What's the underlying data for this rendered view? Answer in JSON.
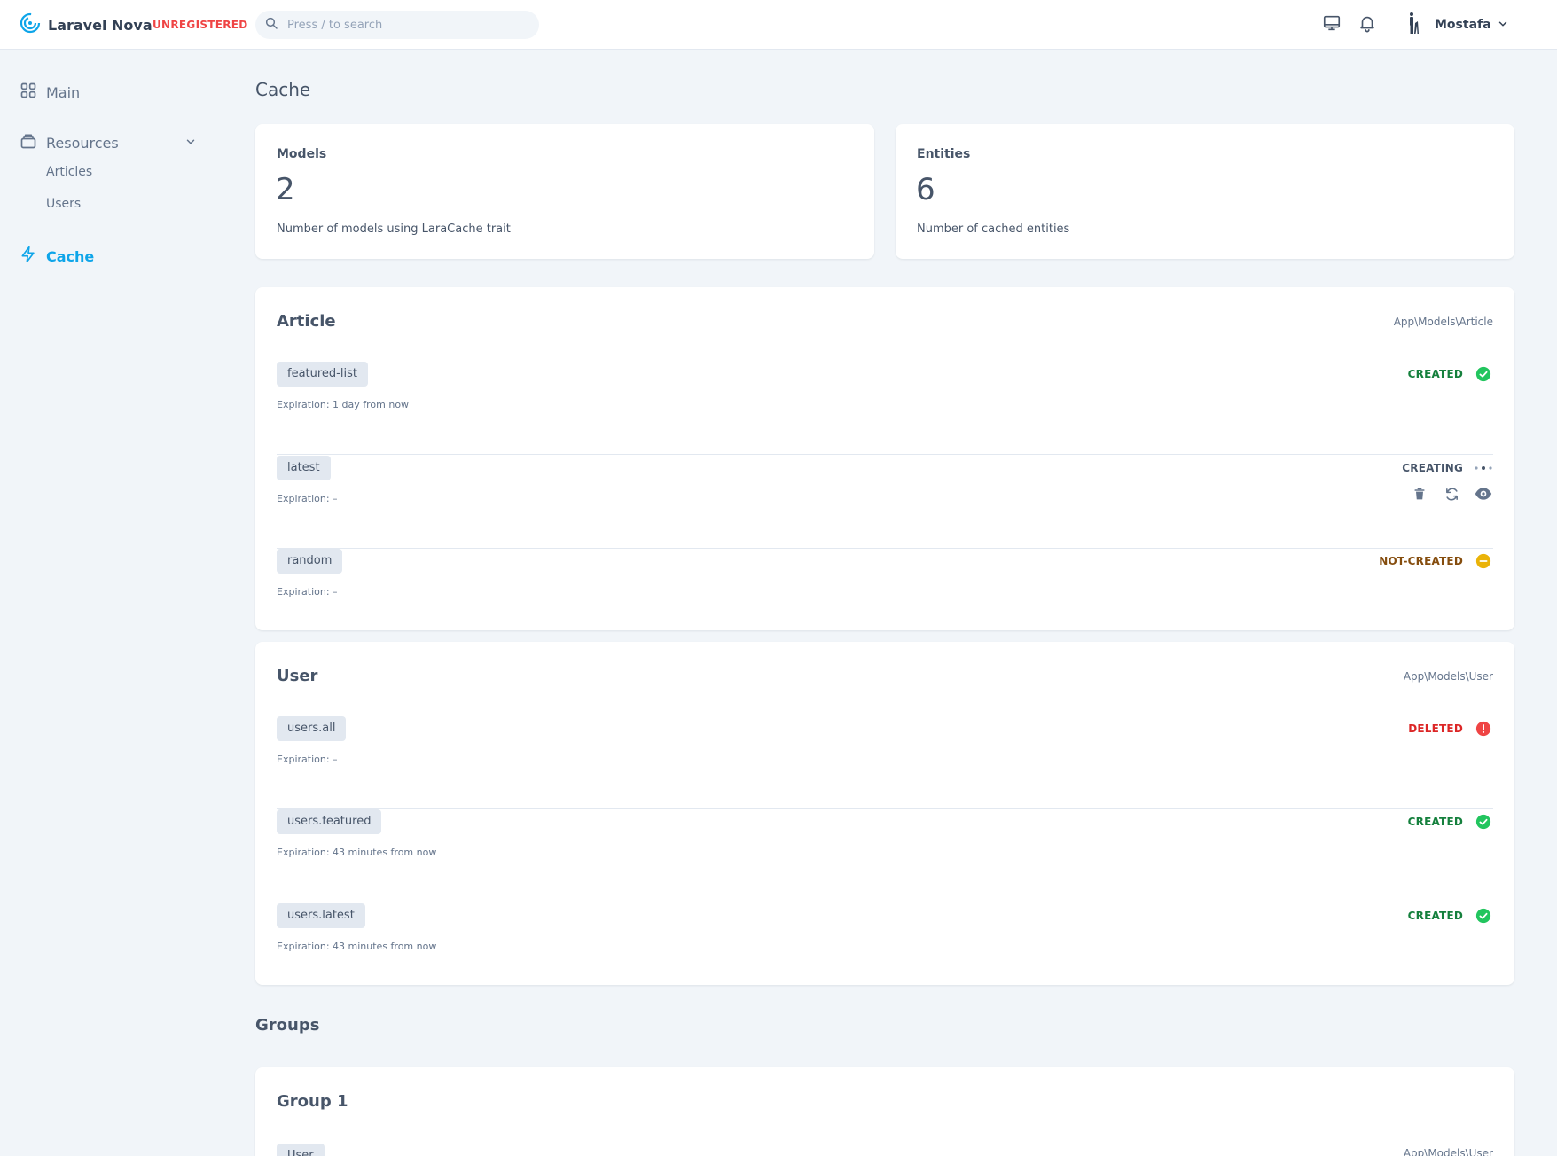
{
  "app": {
    "name": "Laravel Nova",
    "license_badge": "UNREGISTERED"
  },
  "search": {
    "placeholder": "Press / to search"
  },
  "user": {
    "name": "Mostafa"
  },
  "sidebar": {
    "main_label": "Main",
    "resources_label": "Resources",
    "resource_items": [
      "Articles",
      "Users"
    ],
    "cache_label": "Cache"
  },
  "page": {
    "title": "Cache"
  },
  "metrics": [
    {
      "label": "Models",
      "value": "2",
      "description": "Number of models using LaraCache trait"
    },
    {
      "label": "Entities",
      "value": "6",
      "description": "Number of cached entities"
    }
  ],
  "models": [
    {
      "title": "Article",
      "class": "App\\Models\\Article",
      "entries": [
        {
          "name": "featured-list",
          "expiration": "Expiration: 1 day from now",
          "status": "CREATED",
          "status_icon": "check-circle-icon"
        },
        {
          "name": "latest",
          "expiration": "Expiration: –",
          "status": "CREATING",
          "status_icon": "dots-icon"
        },
        {
          "name": "random",
          "expiration": "Expiration: –",
          "status": "NOT-CREATED",
          "status_icon": "minus-circle-icon"
        }
      ]
    },
    {
      "title": "User",
      "class": "App\\Models\\User",
      "entries": [
        {
          "name": "users.all",
          "expiration": "Expiration: –",
          "status": "DELETED",
          "status_icon": "exclamation-circle-icon"
        },
        {
          "name": "users.featured",
          "expiration": "Expiration: 43 minutes from now",
          "status": "CREATED",
          "status_icon": "check-circle-icon"
        },
        {
          "name": "users.latest",
          "expiration": "Expiration: 43 minutes from now",
          "status": "CREATED",
          "status_icon": "check-circle-icon"
        }
      ]
    }
  ],
  "groups": {
    "title": "Groups",
    "items": [
      {
        "title": "Group 1",
        "tag": "User",
        "class": "App\\Models\\User"
      }
    ]
  },
  "colors": {
    "accent": "#0ea5e9",
    "created": "#22c55e",
    "not_created": "#eab308",
    "deleted": "#ef4444",
    "background": "#f1f5f9"
  }
}
